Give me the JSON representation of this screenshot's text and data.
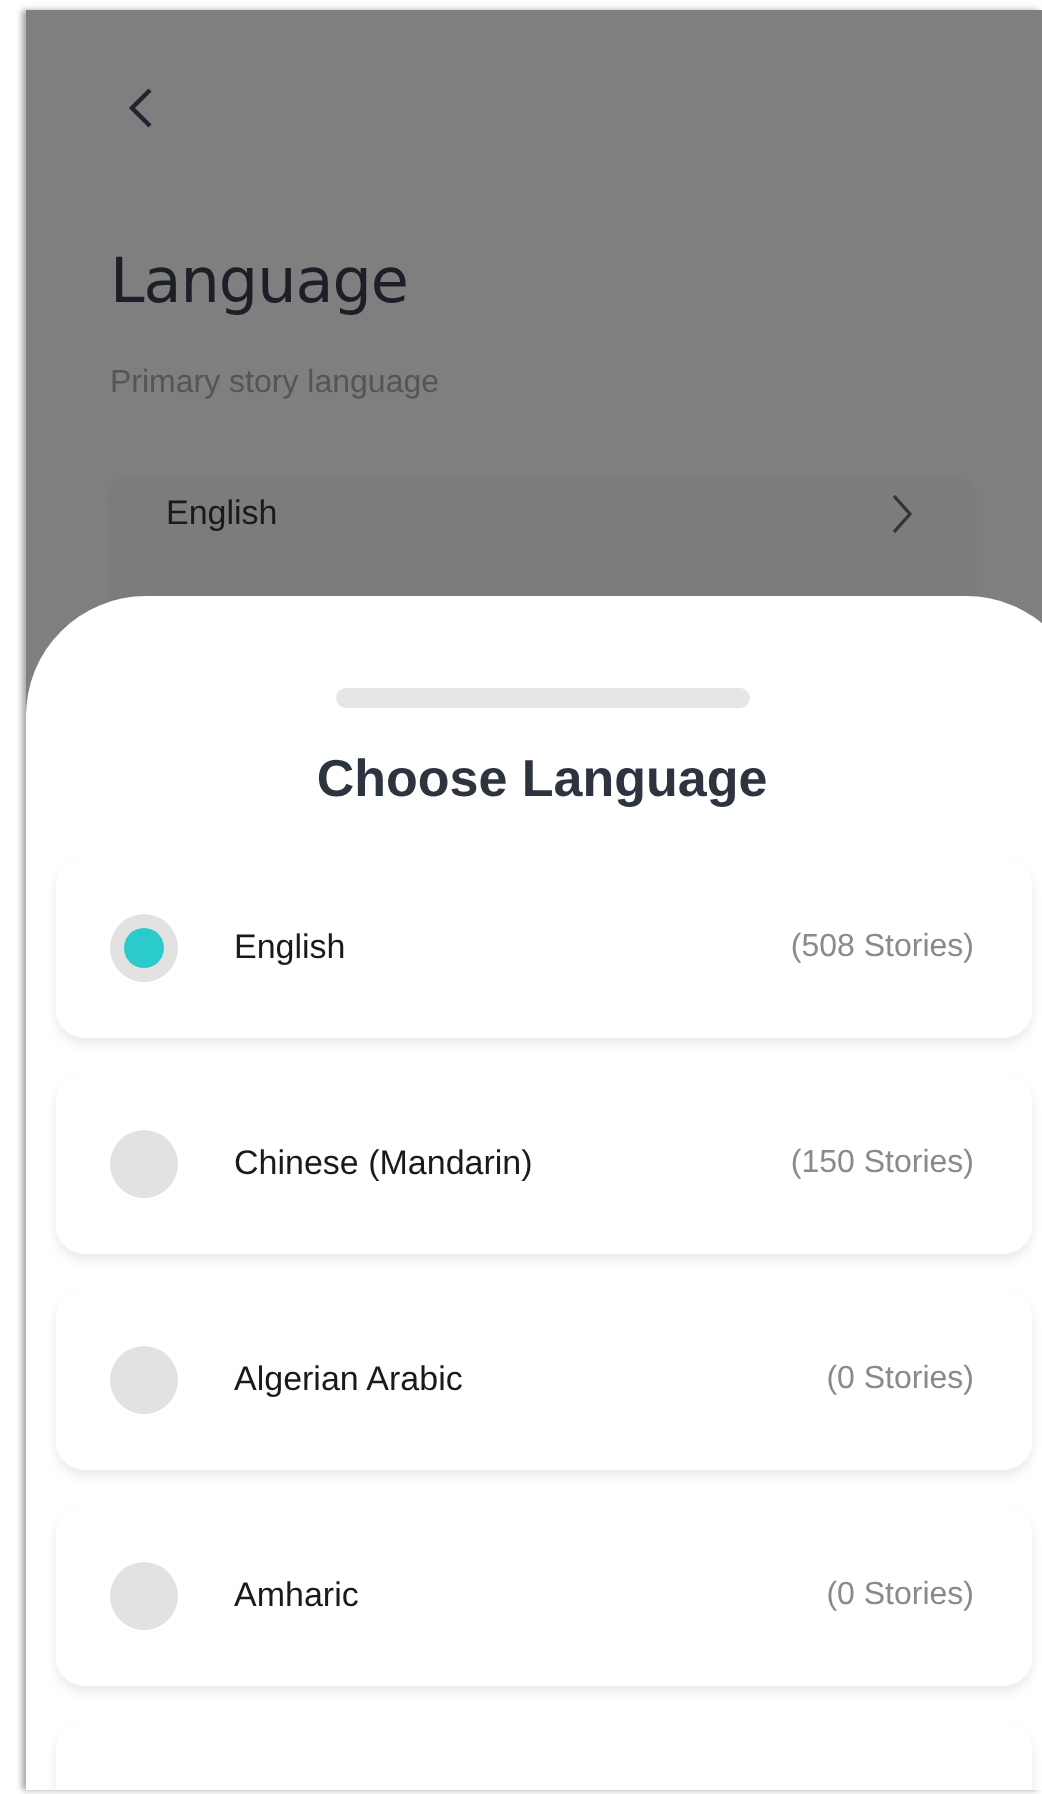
{
  "page": {
    "title": "Language",
    "subtitle": "Primary story language",
    "current_language": "English"
  },
  "sheet": {
    "title": "Choose Language",
    "languages": [
      {
        "name": "English",
        "count": "(508 Stories)",
        "selected": true
      },
      {
        "name": "Chinese (Mandarin)",
        "count": "(150 Stories)",
        "selected": false
      },
      {
        "name": "Algerian Arabic",
        "count": "(0 Stories)",
        "selected": false
      },
      {
        "name": "Amharic",
        "count": "(0 Stories)",
        "selected": false
      }
    ]
  }
}
